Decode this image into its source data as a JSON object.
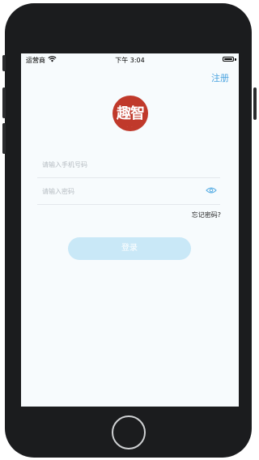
{
  "status_bar": {
    "carrier": "运营商",
    "time": "下午 3:04"
  },
  "header": {
    "register_label": "注册"
  },
  "logo": {
    "text": "趣智"
  },
  "form": {
    "phone_placeholder": "请输入手机号码",
    "password_placeholder": "请输入密码",
    "forgot_label": "忘记密码?",
    "login_label": "登录"
  },
  "colors": {
    "accent": "#4aa3e0",
    "login_button_bg": "#c9e8f7",
    "logo_bg": "#c0392b",
    "device_frame": "#1b1c1e"
  }
}
